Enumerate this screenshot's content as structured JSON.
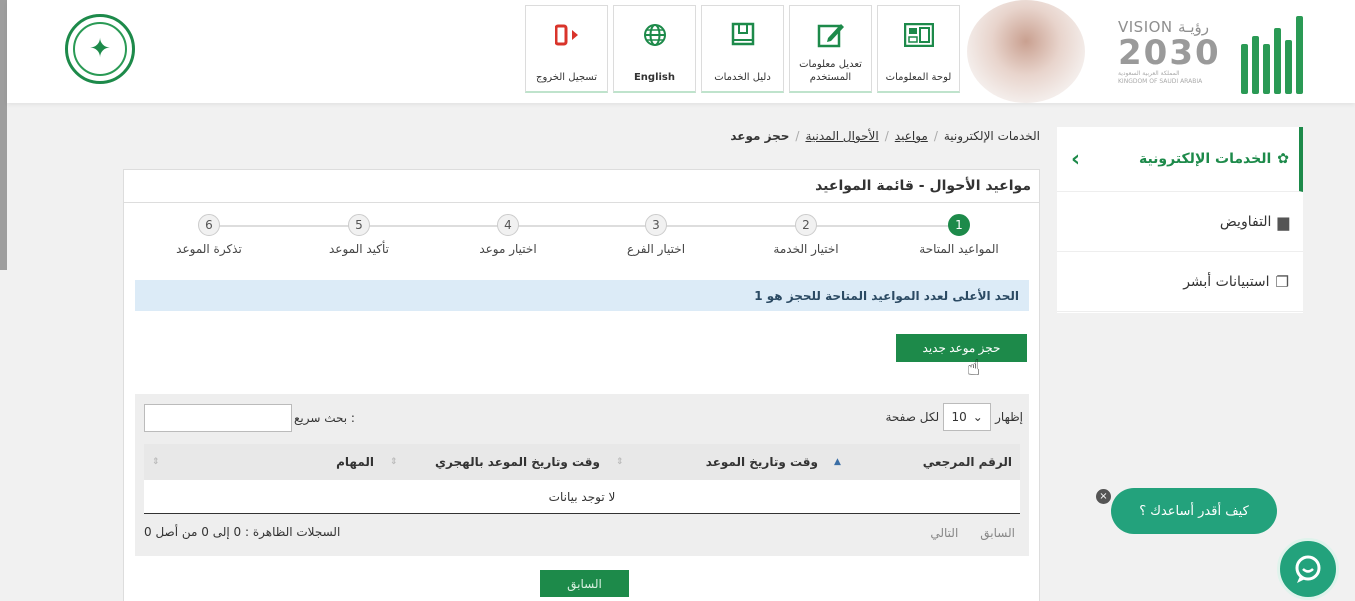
{
  "header": {
    "tiles": [
      {
        "label": "تسجيل الخروج",
        "icon": "logout-icon"
      },
      {
        "label": "English",
        "icon": "globe-icon"
      },
      {
        "label": "دليل الخدمات",
        "icon": "book-icon"
      },
      {
        "label": "تعديل معلومات المستخدم",
        "icon": "edit-icon"
      },
      {
        "label": "لوحة المعلومات",
        "icon": "dashboard-icon"
      }
    ],
    "vision_top": "VISION رؤيـة",
    "vision_year": "2030",
    "vision_sub_ar": "المملكة العربية السعودية",
    "vision_sub_en": "KINGDOM OF SAUDI ARABIA"
  },
  "sidebar": {
    "items": [
      {
        "label": "الخدمات الإلكترونية",
        "icon": "eservices-icon",
        "active": true
      },
      {
        "label": "التفاويض",
        "icon": "briefcase-icon"
      },
      {
        "label": "استبيانات أبشر",
        "icon": "survey-icon"
      }
    ]
  },
  "breadcrumb": {
    "items": [
      "الخدمات الإلكترونية",
      "مواعيد",
      "الأحوال المدنية",
      "حجز موعد"
    ]
  },
  "panel": {
    "title": "مواعيد الأحوال - قائمة المواعيد",
    "steps": [
      {
        "num": "1",
        "label": "المواعيد المتاحة"
      },
      {
        "num": "2",
        "label": "اختيار الخدمة"
      },
      {
        "num": "3",
        "label": "اختيار الفرع"
      },
      {
        "num": "4",
        "label": "اختيار موعد"
      },
      {
        "num": "5",
        "label": "تأكيد الموعد"
      },
      {
        "num": "6",
        "label": "تذكرة الموعد"
      }
    ],
    "info": "الحد الأعلى لعدد المواعيد المتاحة للحجز هو 1",
    "new_button": "حجز موعد جديد",
    "show_prefix": "إظهار",
    "show_value": "10",
    "show_suffix": "لكل صفحة",
    "search_label": "بحث سريع :",
    "search_value": "",
    "columns": [
      "الرقم المرجعي",
      "وقت وتاريخ الموعد",
      "وقت وتاريخ الموعد بالهجري",
      "المهام"
    ],
    "no_data": "لا توجد بيانات",
    "records": "السجلات الظاهرة : 0 إلى 0 من أصل 0",
    "prev": "السابق",
    "next": "التالي",
    "back_button": "السابق"
  },
  "chat": {
    "bubble": "كيف أقدر أساعدك ؟",
    "close": "×"
  },
  "colors": {
    "primary": "#1d8a4a",
    "chat": "#23a27c",
    "info_bg": "#dcebf7"
  }
}
